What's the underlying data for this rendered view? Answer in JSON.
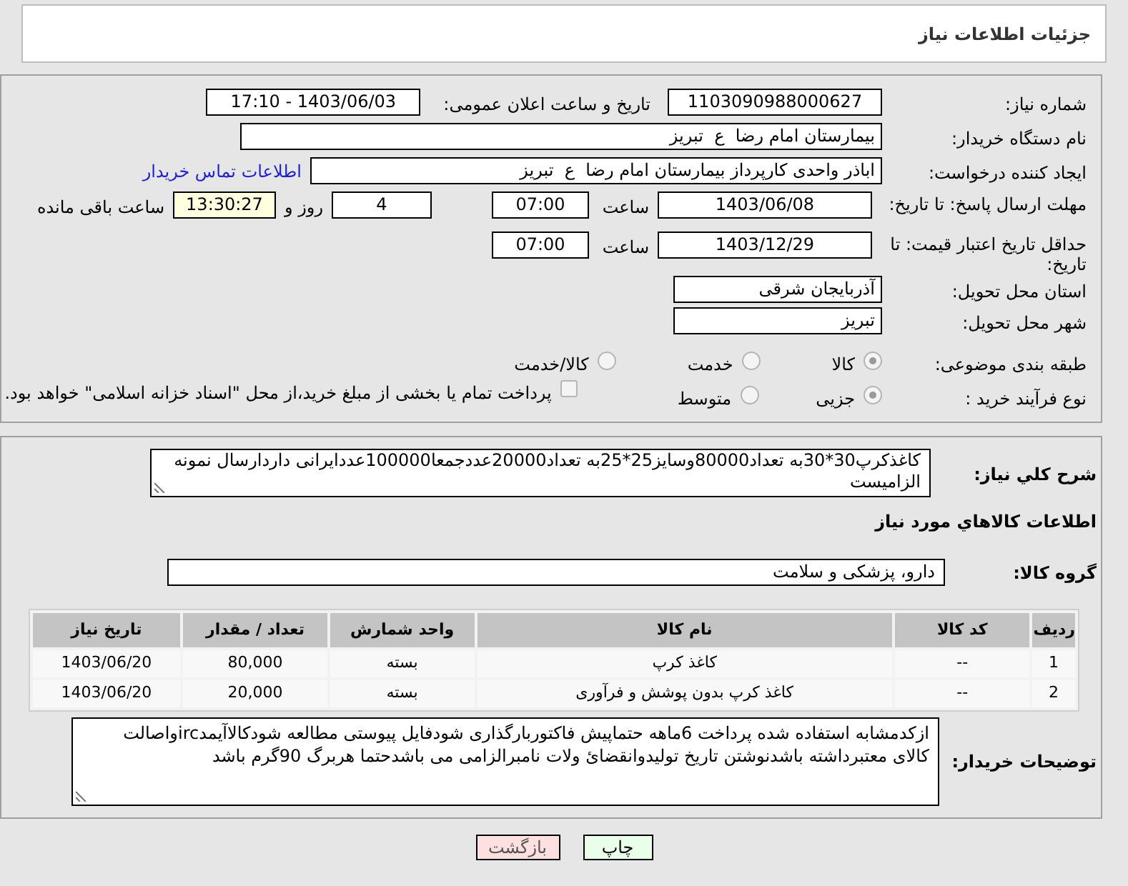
{
  "header": {
    "title": "جزئیات اطلاعات نیاز"
  },
  "need_number": {
    "label": "شماره نیاز:",
    "value": "1103090988000627"
  },
  "announce": {
    "label": "تاریخ و ساعت اعلان عمومی:",
    "value": "1403/06/03 - 17:10"
  },
  "buyer": {
    "label": "نام دستگاه خریدار:",
    "value": "بیمارستان امام رضا  ع  تبریز"
  },
  "creator": {
    "label": "ایجاد کننده درخواست:",
    "value": "اباذر واحدی کارپرداز بیمارستان امام رضا  ع  تبریز",
    "link": "اطلاعات تماس خریدار"
  },
  "deadline": {
    "label": "مهلت ارسال پاسخ: تا تاریخ:",
    "date": "1403/06/08",
    "time_label": "ساعت",
    "time": "07:00",
    "days": "4",
    "days_label": "روز و",
    "remaining": "13:30:27",
    "remaining_label": "ساعت باقی مانده"
  },
  "validity": {
    "label": "حداقل تاریخ اعتبار قیمت: تا تاریخ:",
    "date": "1403/12/29",
    "time_label": "ساعت",
    "time": "07:00"
  },
  "province": {
    "label": "استان محل تحویل:",
    "value": "آذربایجان شرقی"
  },
  "city": {
    "label": "شهر محل تحویل:",
    "value": "تبریز"
  },
  "category": {
    "label": "طبقه بندی موضوعی:",
    "options": [
      {
        "label": "کالا",
        "selected": true
      },
      {
        "label": "خدمت",
        "selected": false
      },
      {
        "label": "کالا/خدمت",
        "selected": false
      }
    ]
  },
  "process": {
    "label": "نوع فرآیند خرید :",
    "options": [
      {
        "label": "جزیی",
        "selected": true
      },
      {
        "label": "متوسط",
        "selected": false
      }
    ],
    "payment": {
      "checked": false,
      "text": "پرداخت تمام یا بخشی از مبلغ خرید،از محل \"اسناد خزانه اسلامی\" خواهد بود."
    }
  },
  "description": {
    "label": "شرح كلي نياز:",
    "value": "کاغذکرپ30*30به تعداد80000وسایز25*25به تعداد20000عددجمعا100000عددایرانی داردارسال نمونه الزامیست"
  },
  "goods_title": "اطلاعات كالاهاي مورد نياز",
  "goods_group": {
    "label": "گروه كالا:",
    "value": "دارو، پزشکی و سلامت"
  },
  "table": {
    "columns": [
      "ردیف",
      "کد کالا",
      "نام کالا",
      "واحد شمارش",
      "تعداد / مقدار",
      "تاریخ نیاز"
    ],
    "rows": [
      [
        "1",
        "--",
        "کاغذ کرپ",
        "بسته",
        "80,000",
        "1403/06/20"
      ],
      [
        "2",
        "--",
        "کاغذ کرپ بدون پوشش و فرآوری",
        "بسته",
        "20,000",
        "1403/06/20"
      ]
    ]
  },
  "buyer_notes": {
    "label": "توضیحات خریدار:",
    "value": "ازکدمشابه استفاده شده پرداخت 6ماهه حتماپیش فاکتوربارگذاری شودفایل پیوستی مطالعه شودکالاآیمدircواصالت کالای معتبرداشته باشدنوشتن تاریخ تولیدوانقضائ ولات نامبرالزامی می باشدحتما هربرگ 90گرم باشد"
  },
  "buttons": [
    {
      "kind": "print",
      "label": "چاپ"
    },
    {
      "kind": "back",
      "label": "بازگشت"
    }
  ]
}
